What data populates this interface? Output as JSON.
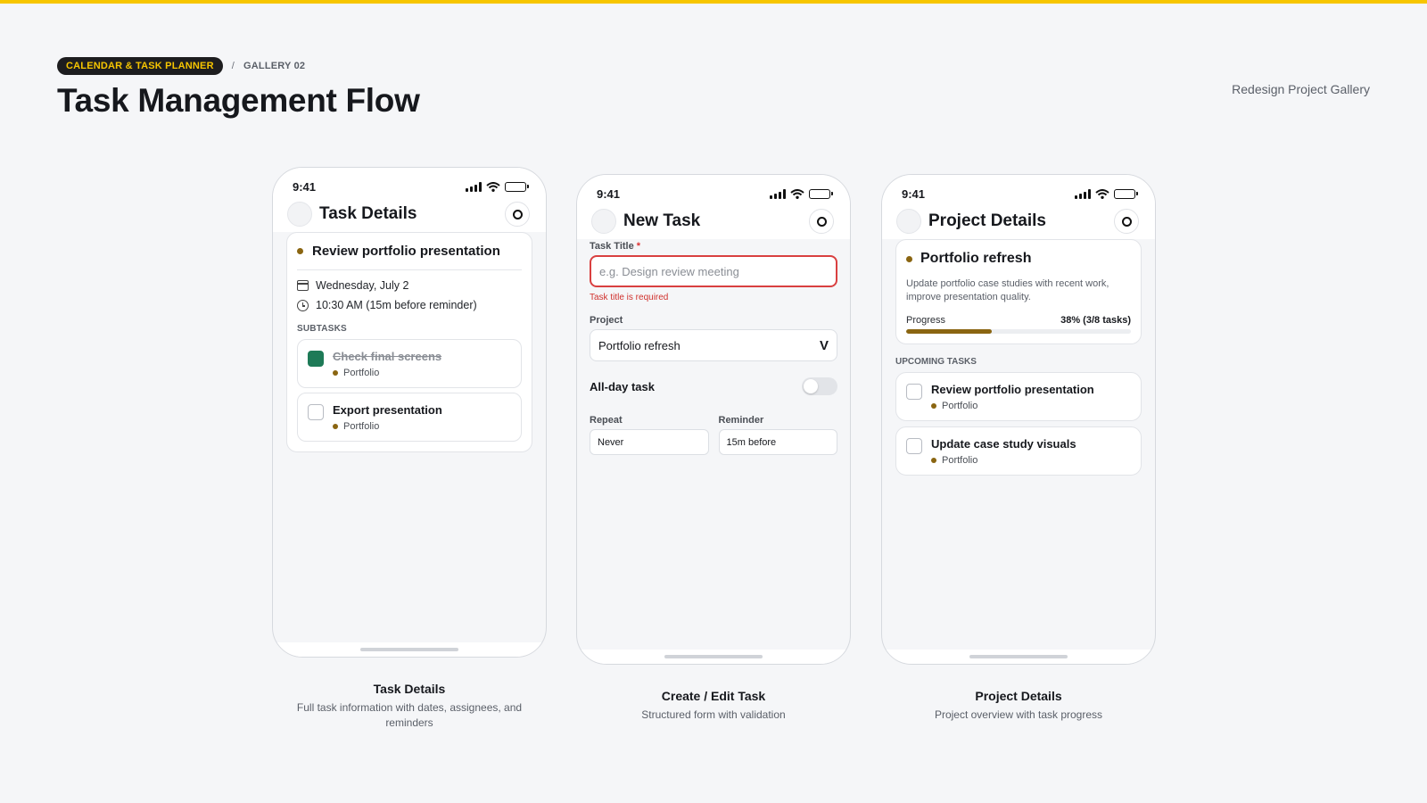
{
  "header": {
    "pill": "CALENDAR & TASK PLANNER",
    "separator": "/",
    "gallery": "GALLERY 02",
    "title": "Task Management Flow",
    "right_label": "Redesign Project Gallery"
  },
  "colors": {
    "accent_yellow": "#f7c600",
    "project_gold": "#8a6511",
    "done_green": "#1e7a57",
    "error_red": "#d94040"
  },
  "status_time": "9:41",
  "phone1": {
    "title": "Task Details",
    "task": "Review portfolio presentation",
    "date": "Wednesday, July 2",
    "time": "10:30 AM (15m before reminder)",
    "subtasks_label": "SUBTASKS",
    "subtasks": [
      {
        "title": "Check final screens",
        "tag": "Portfolio",
        "done": true
      },
      {
        "title": "Export presentation",
        "tag": "Portfolio",
        "done": false
      }
    ],
    "caption_title": "Task Details",
    "caption_sub": "Full task information with dates, assignees, and reminders"
  },
  "phone2": {
    "title": "New Task",
    "task_title_label": "Task Title",
    "required_mark": "*",
    "task_title_placeholder": "e.g. Design review meeting",
    "task_title_error": "Task title is required",
    "project_label": "Project",
    "project_value": "Portfolio refresh",
    "allday_label": "All-day task",
    "allday_on": false,
    "repeat_label": "Repeat",
    "repeat_value": "Never",
    "reminder_label": "Reminder",
    "reminder_value": "15m before",
    "caption_title": "Create / Edit Task",
    "caption_sub": "Structured form with validation"
  },
  "phone3": {
    "title": "Project Details",
    "project": "Portfolio refresh",
    "description": "Update portfolio case studies with recent work, improve presentation quality.",
    "progress_label": "Progress",
    "progress_value": "38% (3/8 tasks)",
    "progress_fraction": 0.38,
    "upcoming_label": "UPCOMING TASKS",
    "upcoming": [
      {
        "title": "Review portfolio presentation",
        "tag": "Portfolio"
      },
      {
        "title": "Update case study visuals",
        "tag": "Portfolio"
      }
    ],
    "caption_title": "Project Details",
    "caption_sub": "Project overview with task progress"
  }
}
